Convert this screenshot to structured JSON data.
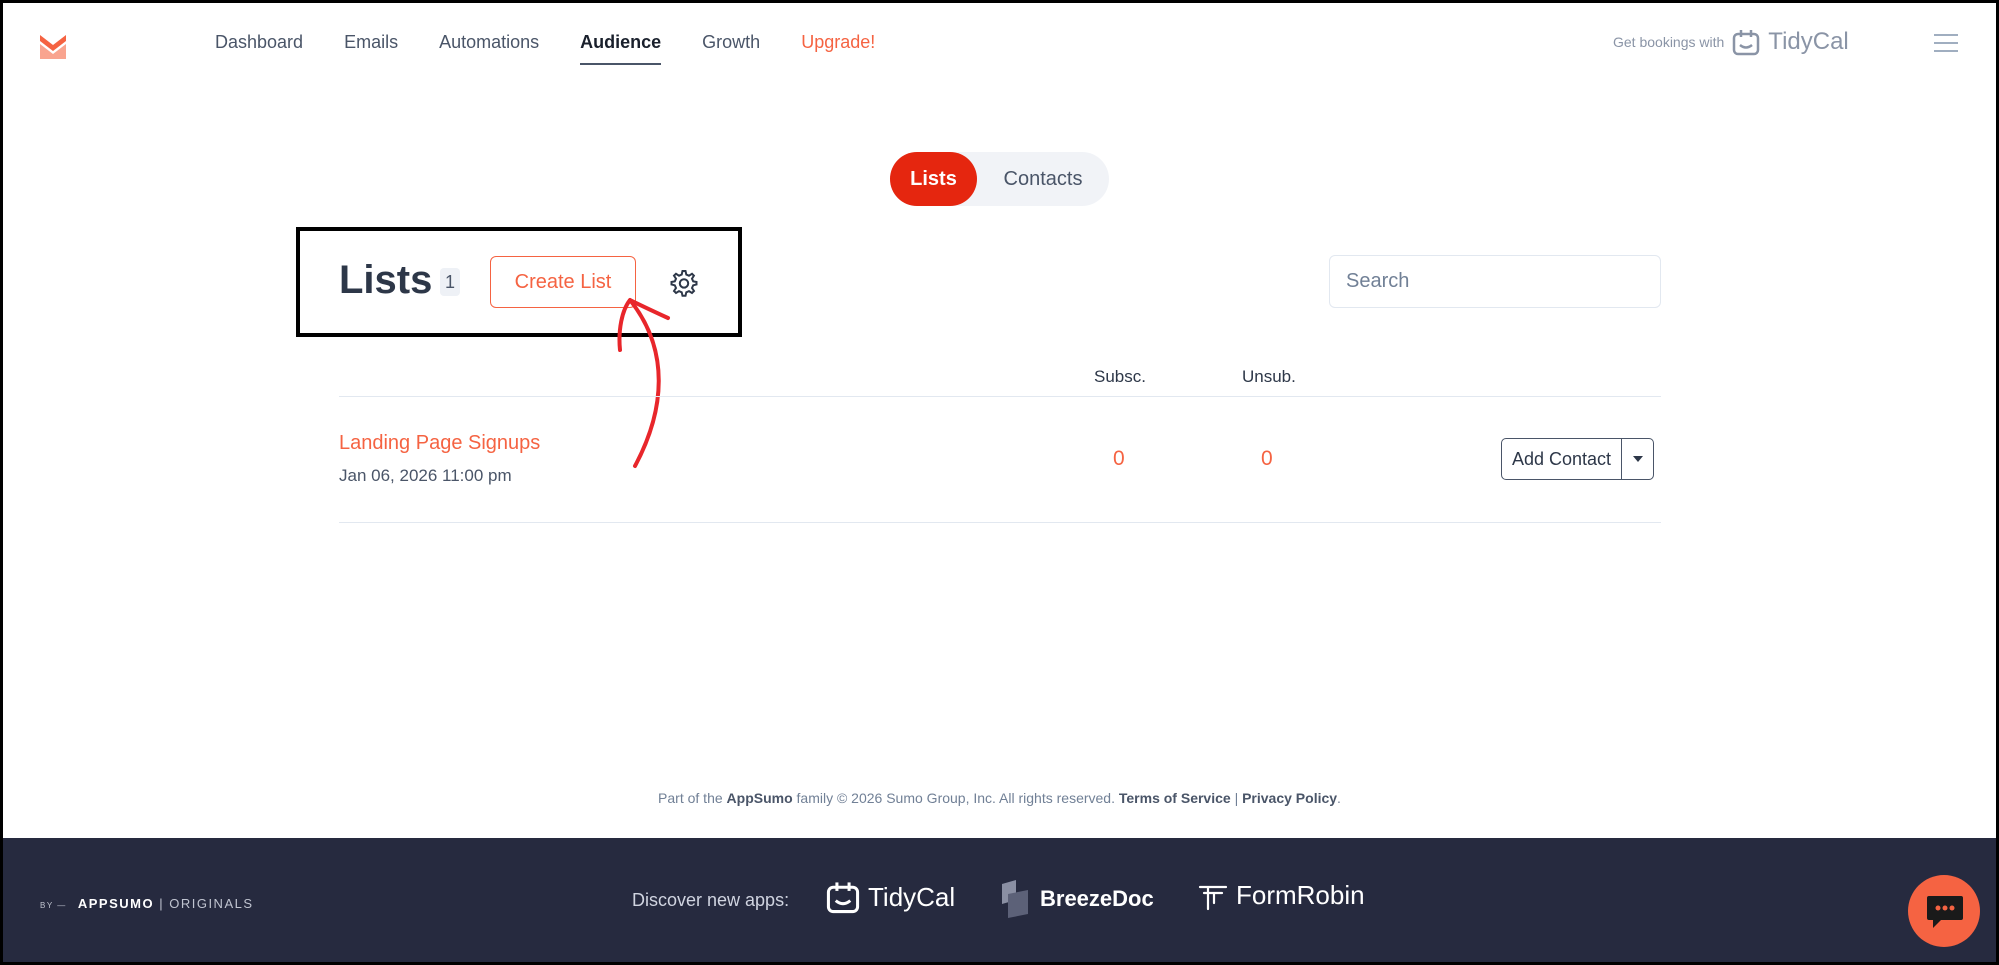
{
  "nav": {
    "items": [
      {
        "label": "Dashboard"
      },
      {
        "label": "Emails"
      },
      {
        "label": "Automations"
      },
      {
        "label": "Audience",
        "active": true
      },
      {
        "label": "Growth"
      },
      {
        "label": "Upgrade!"
      }
    ],
    "promo_text": "Get bookings with",
    "promo_brand": "TidyCal"
  },
  "toggle": {
    "active": "Lists",
    "inactive": "Contacts"
  },
  "header": {
    "title": "Lists",
    "count": "1",
    "create_label": "Create List",
    "search_placeholder": "Search"
  },
  "table": {
    "columns": [
      "Subsc.",
      "Unsub."
    ],
    "rows": [
      {
        "name": "Landing Page Signups",
        "date": "Jan 06, 2026 11:00 pm",
        "subscribed": "0",
        "unsubscribed": "0",
        "action": "Add Contact"
      }
    ]
  },
  "footer": {
    "pre": "Part of the",
    "appsumo": "AppSumo",
    "mid": "family © 2026 Sumo Group, Inc. All rights reserved.",
    "terms": "Terms of Service",
    "sep": "|",
    "privacy": "Privacy Policy",
    "end": "."
  },
  "dark_footer": {
    "by": "BY —",
    "appsumo": "APPSUMO",
    "originals": "| ORIGINALS",
    "discover": "Discover new apps:",
    "apps": [
      "TidyCal",
      "BreezeDoc",
      "FormRobin"
    ]
  },
  "colors": {
    "accent": "#f56342",
    "toggle_active": "#e5260f",
    "footer_bg": "#262a3f"
  }
}
